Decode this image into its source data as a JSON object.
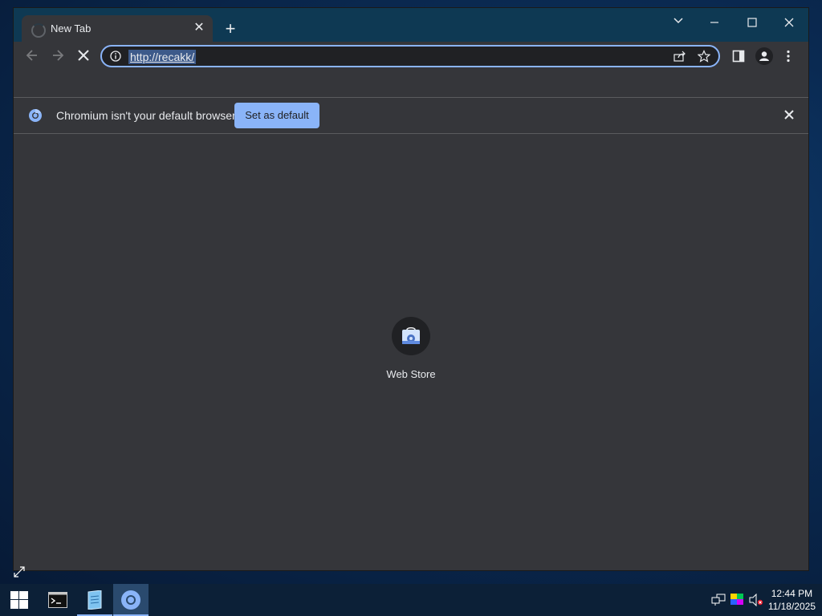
{
  "browser": {
    "tab": {
      "title": "New Tab"
    },
    "omnibox": {
      "url": "http://recakk/"
    },
    "infobar": {
      "message": "Chromium isn't your default browser",
      "set_default_label": "Set as default"
    },
    "shortcuts": [
      {
        "label": "Web Store",
        "icon": "web-store-icon"
      }
    ]
  },
  "taskbar": {
    "time": "12:44 PM",
    "date": "11/18/2025",
    "apps": [
      "start-icon",
      "terminal-icon",
      "notepad-icon",
      "chromium-icon"
    ]
  },
  "colors": {
    "accent": "#8ab4f8",
    "titlebar": "#0e3953",
    "surface": "#35363a"
  }
}
